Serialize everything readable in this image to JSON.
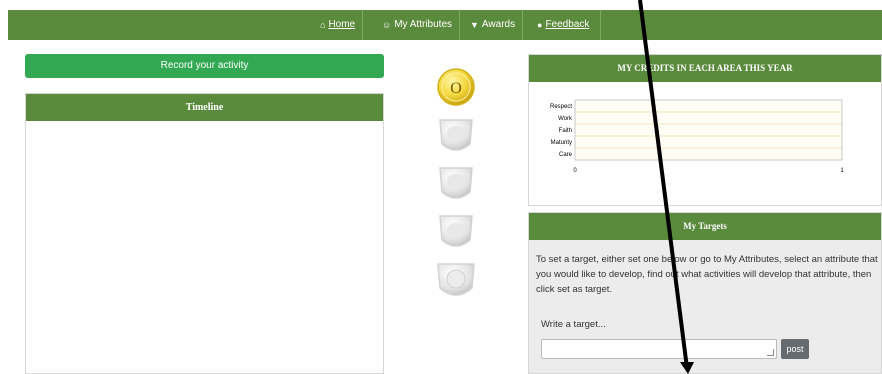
{
  "nav": {
    "items": [
      {
        "label": "Home",
        "icon": "home-icon",
        "glyph": "⌂"
      },
      {
        "label": "My Attributes",
        "icon": "user-icon",
        "glyph": "☺"
      },
      {
        "label": "Awards",
        "icon": "shield-icon",
        "glyph": "▼"
      },
      {
        "label": "Feedback",
        "icon": "comment-icon",
        "glyph": "●"
      }
    ]
  },
  "record_button": "Record your activity",
  "timeline": {
    "title": "Timeline"
  },
  "badges": [
    {
      "icon": "gold-badge-icon",
      "label": "O"
    },
    {
      "icon": "silver-shield-icon"
    },
    {
      "icon": "silver-shield-icon"
    },
    {
      "icon": "silver-shield-icon"
    },
    {
      "icon": "silver-badge-icon"
    }
  ],
  "credits": {
    "title": "MY CREDITS IN EACH AREA THIS YEAR"
  },
  "chart_data": {
    "type": "bar",
    "orientation": "horizontal",
    "categories": [
      "Respect",
      "Work",
      "Faith",
      "Maturity",
      "Care"
    ],
    "values": [
      0,
      0,
      0,
      0,
      0
    ],
    "xlim": [
      0,
      1
    ],
    "xticks": [
      "0",
      "1"
    ],
    "title": "MY CREDITS IN EACH AREA THIS YEAR"
  },
  "targets": {
    "title": "My Targets",
    "description": "To set a target, either set one below or go to My Attributes, select an attribute that you would like to develop, find out what activities will develop that attribute, then click set as target.",
    "write_label": "Write a target...",
    "input_value": "",
    "post_label": "post"
  },
  "colors": {
    "nav": "#5a8a3c",
    "button": "#32a852",
    "chart_fill": "#fffef4"
  }
}
